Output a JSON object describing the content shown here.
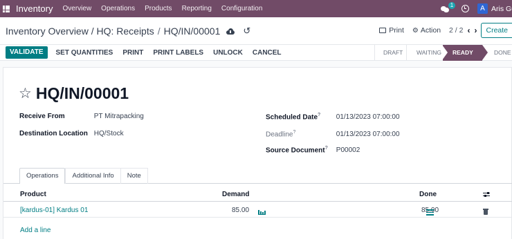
{
  "navbar": {
    "app_name": "Inventory",
    "menu": [
      "Overview",
      "Operations",
      "Products",
      "Reporting",
      "Configuration"
    ],
    "chat_badge": "1",
    "avatar_letter": "A",
    "user_name": "Aris Guntara"
  },
  "control": {
    "breadcrumb_parent": "Inventory Overview / HQ: Receipts",
    "breadcrumb_sep": "/",
    "breadcrumb_current": "HQ/IN/00001",
    "print_label": "Print",
    "action_label": "Action",
    "pager": "2 / 2",
    "create_label": "Create"
  },
  "statusbar": {
    "validate_label": "VALIDATE",
    "buttons": [
      "SET QUANTITIES",
      "PRINT",
      "PRINT LABELS",
      "UNLOCK",
      "CANCEL"
    ],
    "stages": [
      "DRAFT",
      "WAITING",
      "READY",
      "DONE"
    ],
    "active_stage": "READY"
  },
  "record": {
    "title": "HQ/IN/00001",
    "receive_from_label": "Receive From",
    "receive_from_value": "PT Mitrapacking",
    "destination_label": "Destination Location",
    "destination_value": "HQ/Stock",
    "scheduled_date_label": "Scheduled Date",
    "scheduled_date_value": "01/13/2023 07:00:00",
    "deadline_label": "Deadline",
    "deadline_value": "01/13/2023 07:00:00",
    "source_document_label": "Source Document",
    "source_document_value": "P00002",
    "help_mark": "?"
  },
  "tabs": [
    "Operations",
    "Additional Info",
    "Note"
  ],
  "table": {
    "headers": {
      "product": "Product",
      "demand": "Demand",
      "done": "Done"
    },
    "rows": [
      {
        "product": "[kardus-01] Kardus 01",
        "demand": "85.00",
        "done": "85.00"
      }
    ],
    "add_line_label": "Add a line"
  },
  "colors": {
    "brand": "#714b67",
    "accent": "#017e84"
  }
}
